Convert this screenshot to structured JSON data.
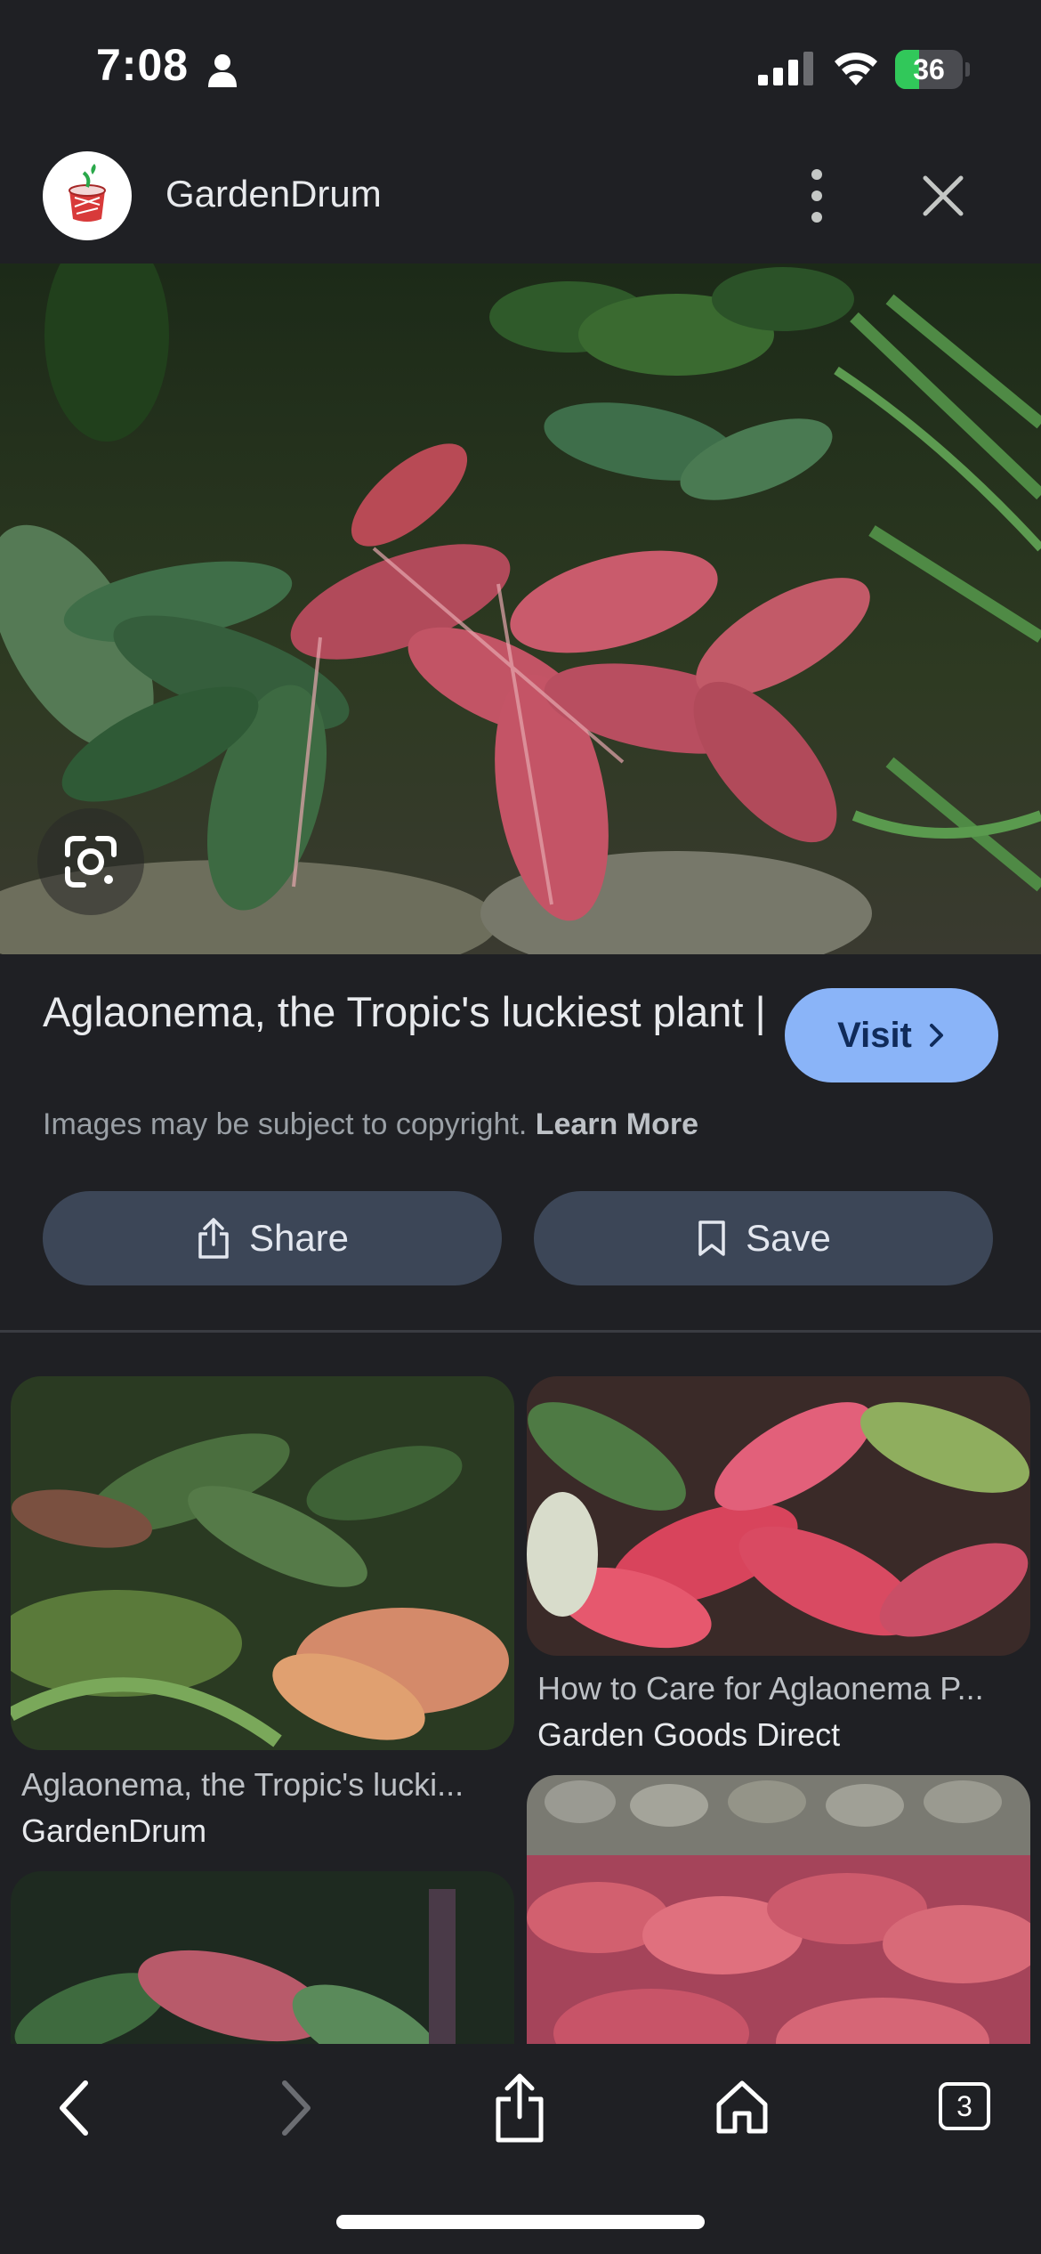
{
  "status_bar": {
    "time": "7:08",
    "battery_level": "36",
    "battery_fraction": 0.36,
    "person_icon": "person-icon",
    "signal_icon": "cellular-signal-icon",
    "wifi_icon": "wifi-icon",
    "battery_icon": "battery-charging-icon"
  },
  "header": {
    "site_name": "GardenDrum",
    "logo_icon": "drum-logo",
    "more_icon": "more-vertical-icon",
    "close_icon": "close-icon"
  },
  "hero": {
    "image_subject": "aglaonema-garden-bed",
    "lens_icon": "google-lens-icon"
  },
  "result": {
    "title": "Aglaonema, the Tropic's luckiest plant |",
    "visit_label": "Visit",
    "copyright_text": "Images may be subject to copyright.",
    "learn_more_label": "Learn More"
  },
  "actions": {
    "share_label": "Share",
    "save_label": "Save"
  },
  "related": [
    {
      "caption": "Aglaonema, the Tropic's lucki...",
      "source": "GardenDrum"
    },
    {
      "caption": "How to Care for Aglaonema P...",
      "source": "Garden Goods Direct"
    },
    {
      "caption": "",
      "source": ""
    },
    {
      "caption": "",
      "source": ""
    }
  ],
  "bottom_bar": {
    "back_icon": "back-icon",
    "forward_icon": "forward-icon",
    "share_icon": "share-icon",
    "home_icon": "home-icon",
    "tabs_count": "3"
  },
  "colors": {
    "background": "#1f2024",
    "accent": "#8ab4f8",
    "button": "#3c4657"
  }
}
